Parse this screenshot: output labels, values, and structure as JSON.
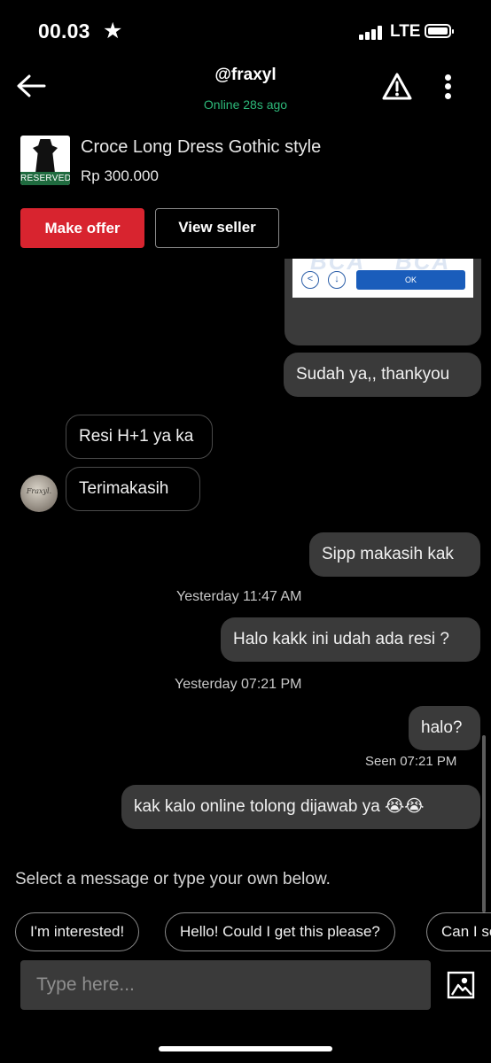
{
  "status_bar": {
    "time": "00.03",
    "star": "★",
    "network": "LTE"
  },
  "header": {
    "username": "@fraxyl",
    "online_status": "Online 28s ago"
  },
  "product": {
    "title": "Croce Long Dress Gothic style",
    "price": "Rp 300.000",
    "badge": "RESERVED"
  },
  "actions": {
    "make_offer": "Make offer",
    "view_seller": "View seller"
  },
  "chat": {
    "image_button_label": "OK",
    "image_watermark": "BCA",
    "messages": [
      {
        "side": "sent",
        "text": "Sudah ya,, thankyou"
      },
      {
        "side": "received",
        "text": "Resi H+1 ya ka"
      },
      {
        "side": "received",
        "text": "Terimakasih"
      },
      {
        "side": "sent",
        "text": "Sipp makasih kak"
      },
      {
        "side": "sent",
        "text": "Halo kakk ini udah ada resi ?"
      },
      {
        "side": "sent",
        "text": "halo?"
      },
      {
        "side": "sent",
        "text": "kak kalo online tolong dijawab ya 😭😭"
      }
    ],
    "timestamps": [
      "Yesterday 11:47 AM",
      "Yesterday 07:21 PM"
    ],
    "seen": "Seen 07:21 PM",
    "avatar_text": "Fraxyl."
  },
  "suggestions": {
    "label": "Select a message or type your own below.",
    "chips": [
      "I'm interested!",
      "Hello! Could I get this please?",
      "Can I se"
    ]
  },
  "composer": {
    "placeholder": "Type here..."
  },
  "colors": {
    "accent_red": "#d8242f",
    "online_green": "#2db97a",
    "bubble_sent": "#3a3a3a"
  }
}
